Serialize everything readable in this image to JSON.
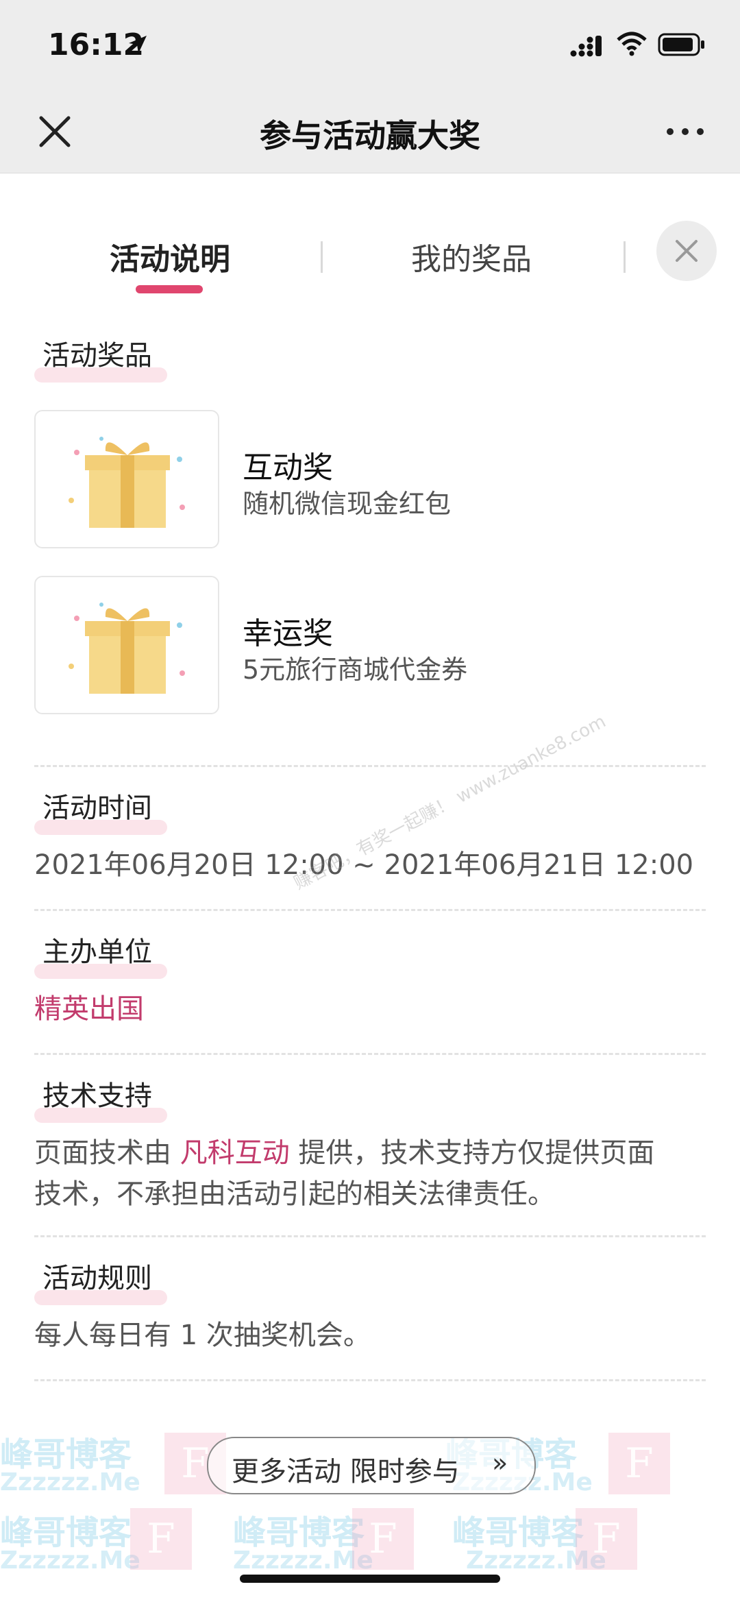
{
  "status_bar": {
    "time": "16:12"
  },
  "nav": {
    "title": "参与活动赢大奖"
  },
  "tabs": [
    {
      "label": "活动说明",
      "active": true
    },
    {
      "label": "我的奖品",
      "active": false
    }
  ],
  "sections": {
    "prizes_title": "活动奖品",
    "prizes": [
      {
        "name": "互动奖",
        "desc": "随机微信现金红包"
      },
      {
        "name": "幸运奖",
        "desc": "5元旅行商城代金券"
      }
    ],
    "time_title": "活动时间",
    "time_value": "2021年06月20日 12:00 ~ 2021年06月21日 12:00",
    "organizer_title": "主办单位",
    "organizer_value": "精英出国",
    "tech_title": "技术支持",
    "tech_line1_prefix": "页面技术由 ",
    "tech_provider": "凡科互动",
    "tech_line1_suffix": " 提供，技术支持方仅提供页面",
    "tech_line2": "技术，不承担由活动引起的相关法律责任。",
    "rules_title": "活动规则",
    "rules_value": "每人每日有 1 次抽奖机会。"
  },
  "more_button": {
    "label": "更多活动 限时参与",
    "arrows": "»"
  },
  "watermarks": {
    "diagonal": "赚客吧，有奖一起赚！ www.zuanke8.com",
    "brand": "峰哥博客",
    "site": "Zzzzzz.Me",
    "logo_letter": "F"
  },
  "colors": {
    "accent": "#e0466e",
    "organizer": "#c23b6c",
    "nav_bg": "#ededed"
  },
  "icons": [
    "location-arrow-icon",
    "signal-icon",
    "wifi-icon",
    "battery-icon",
    "close-icon",
    "more-dots-icon",
    "gift-icon",
    "double-chevron-right-icon"
  ]
}
